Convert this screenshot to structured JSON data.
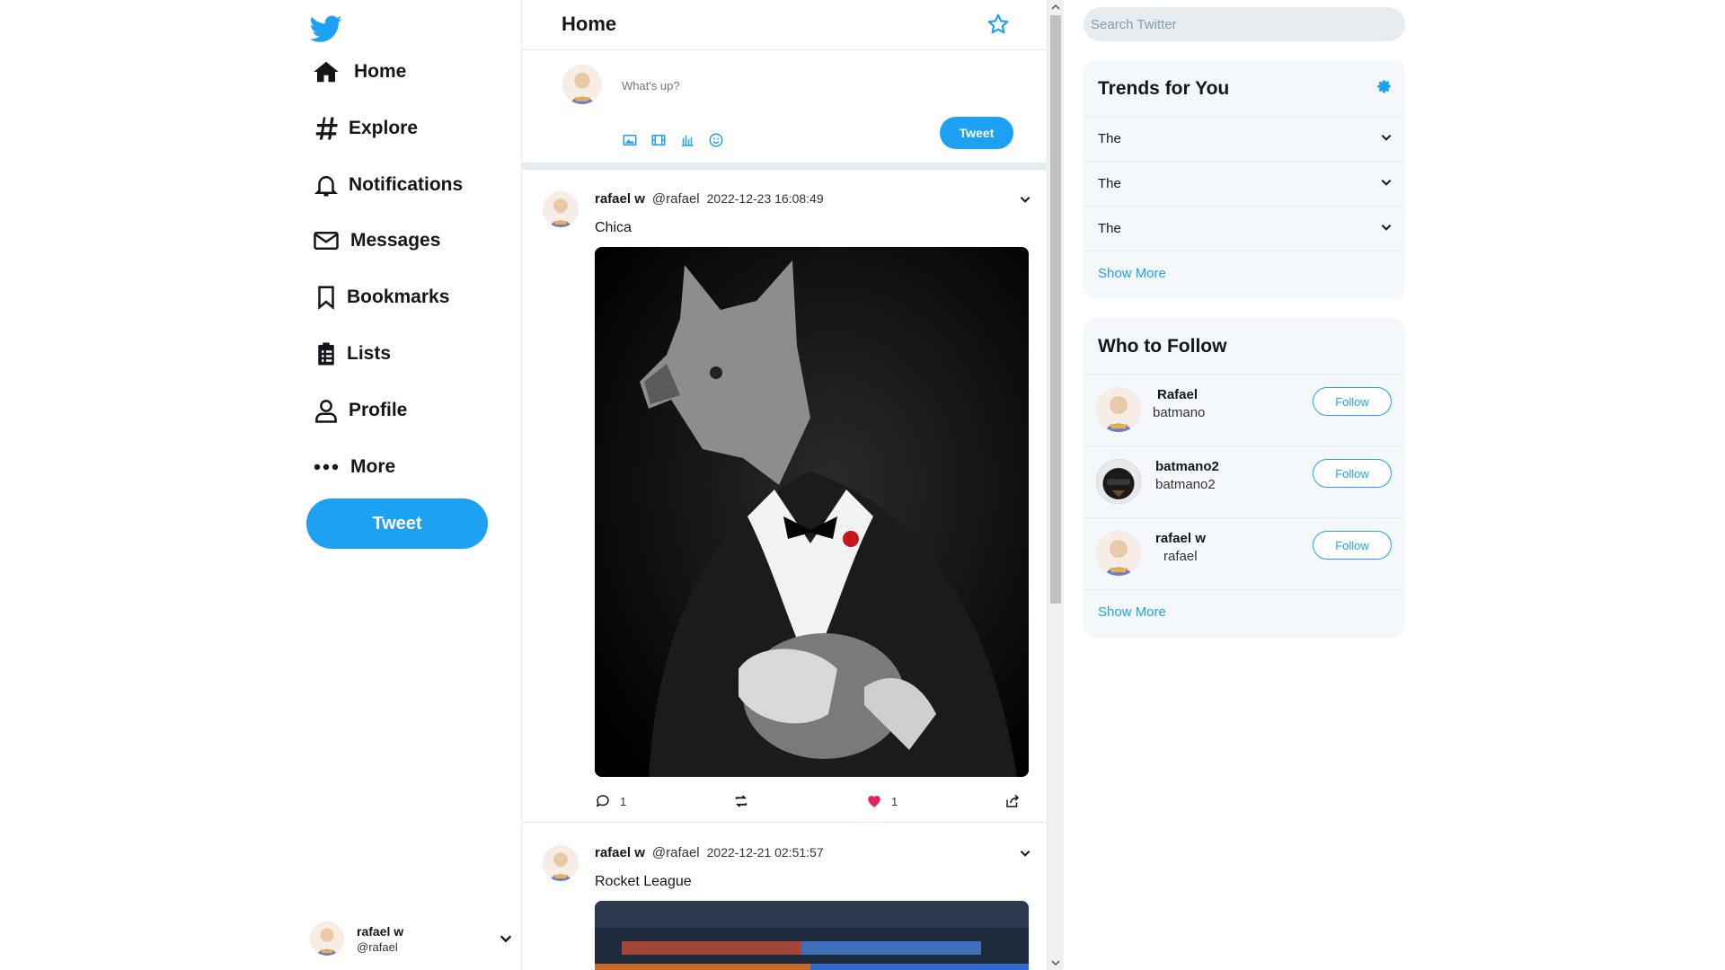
{
  "nav": {
    "items": [
      {
        "label": "Home",
        "icon": "home-icon"
      },
      {
        "label": "Explore",
        "icon": "hashtag-icon"
      },
      {
        "label": "Notifications",
        "icon": "bell-icon"
      },
      {
        "label": "Messages",
        "icon": "envelope-icon"
      },
      {
        "label": "Bookmarks",
        "icon": "bookmark-icon"
      },
      {
        "label": "Lists",
        "icon": "list-icon"
      },
      {
        "label": "Profile",
        "icon": "user-icon"
      },
      {
        "label": "More",
        "icon": "more-dots-icon"
      }
    ],
    "tweet_button": "Tweet"
  },
  "account": {
    "name": "rafael w",
    "handle": "@rafael"
  },
  "feed": {
    "title": "Home",
    "compose": {
      "placeholder": "What's up?",
      "tweet_button": "Tweet"
    },
    "posts": [
      {
        "name": "rafael w",
        "handle": "@rafael",
        "date": "2022-12-23 16:08:49",
        "text": "Chica",
        "replies": "1",
        "likes": "1"
      },
      {
        "name": "rafael w",
        "handle": "@rafael",
        "date": "2022-12-21 02:51:57",
        "text": "Rocket League"
      }
    ]
  },
  "search": {
    "placeholder": "Search Twitter"
  },
  "trends": {
    "title": "Trends for You",
    "items": [
      "The",
      "The",
      "The"
    ],
    "show_more": "Show More"
  },
  "who_to_follow": {
    "title": "Who to Follow",
    "users": [
      {
        "name": "Rafael",
        "handle": "batmano",
        "button": "Follow"
      },
      {
        "name": "batmano2",
        "handle": "batmano2",
        "button": "Follow"
      },
      {
        "name": "rafael w",
        "handle": "rafael",
        "button": "Follow"
      }
    ],
    "show_more": "Show More"
  },
  "colors": {
    "accent": "#1da1f2",
    "like": "#e0245e"
  }
}
